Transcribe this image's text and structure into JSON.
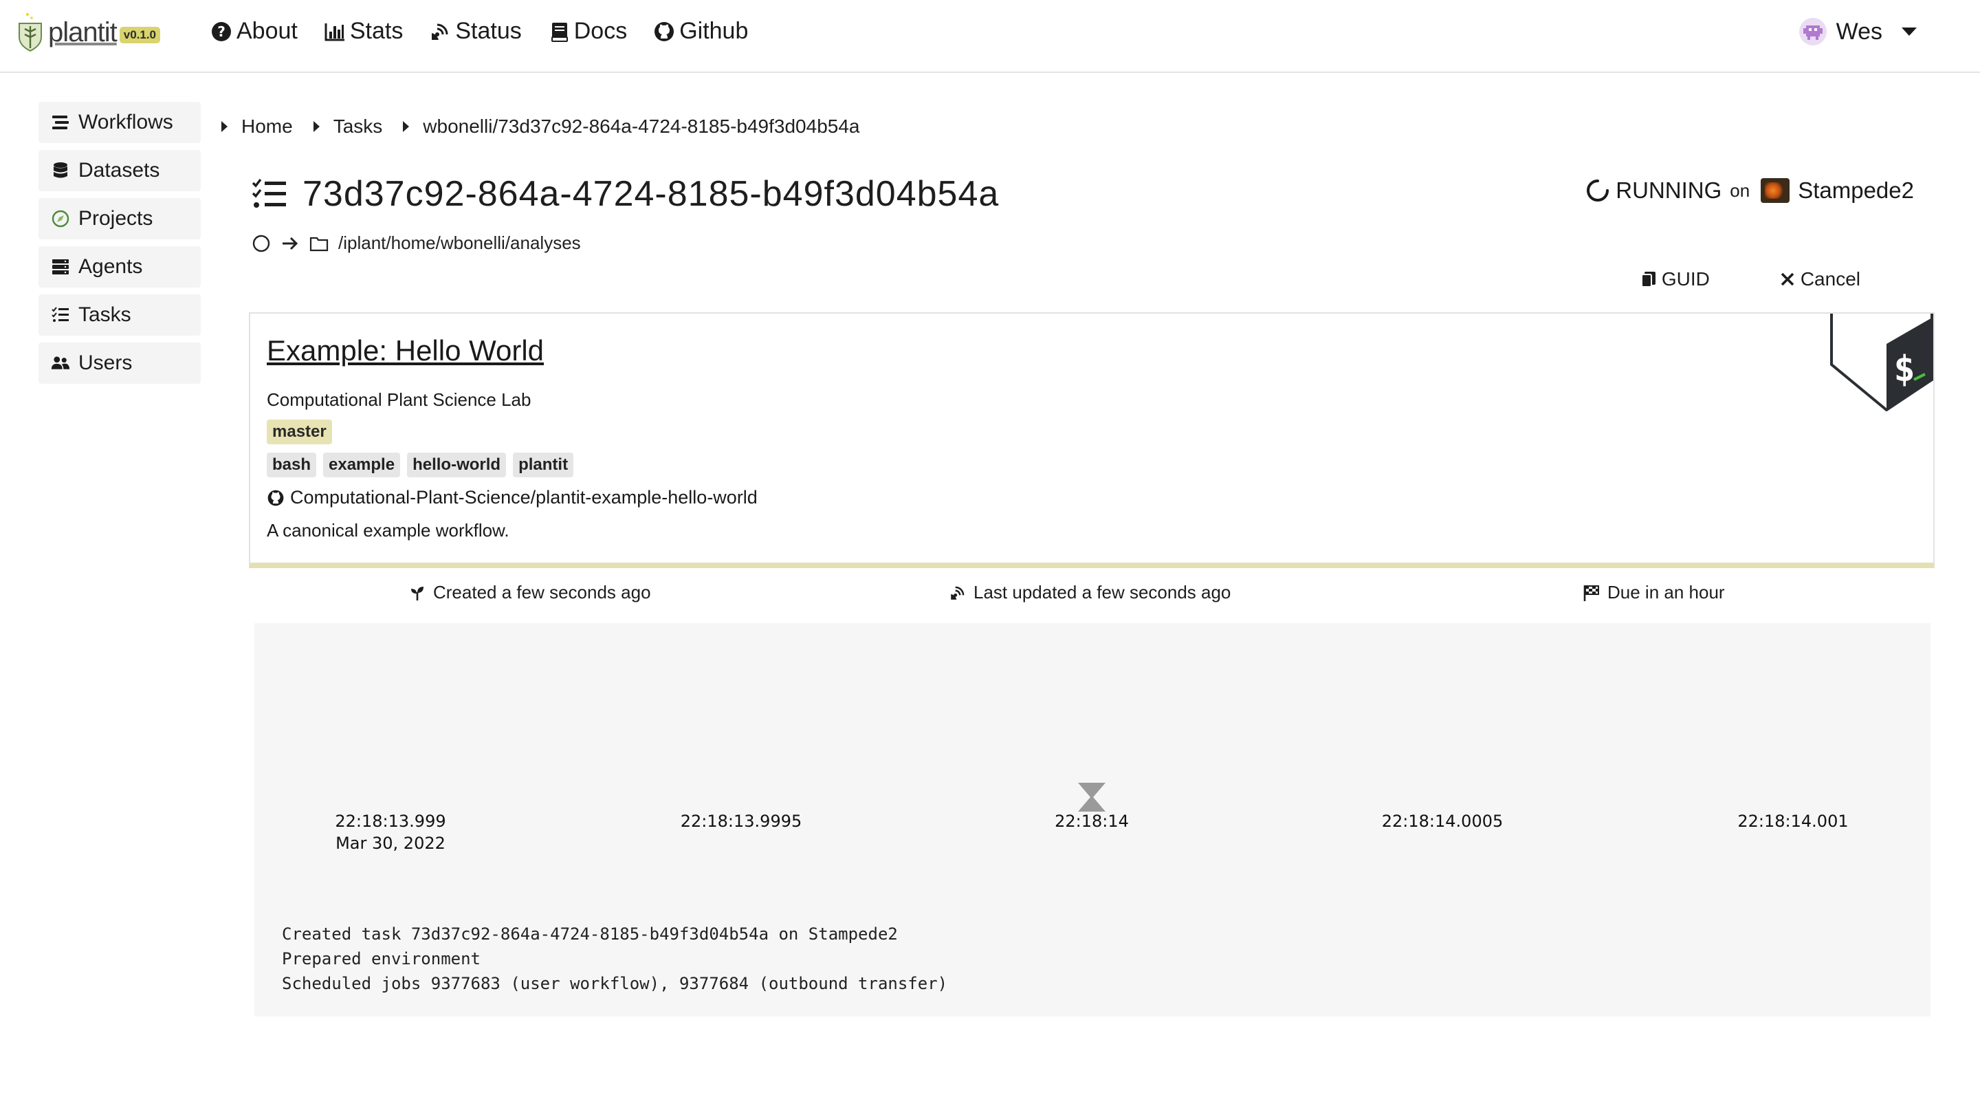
{
  "navbar": {
    "brand_name": "plantit",
    "version": "v0.1.0",
    "links": [
      {
        "label": "About",
        "icon": "question-circle-icon"
      },
      {
        "label": "Stats",
        "icon": "bar-chart-icon"
      },
      {
        "label": "Status",
        "icon": "satellite-dish-icon"
      },
      {
        "label": "Docs",
        "icon": "book-icon"
      },
      {
        "label": "Github",
        "icon": "github-icon"
      }
    ],
    "user": {
      "name": "Wes",
      "avatar": "alien-avatar-icon"
    }
  },
  "sidebar": {
    "items": [
      {
        "label": "Workflows",
        "icon": "stream-icon"
      },
      {
        "label": "Datasets",
        "icon": "database-icon"
      },
      {
        "label": "Projects",
        "icon": "compass-icon"
      },
      {
        "label": "Agents",
        "icon": "server-icon"
      },
      {
        "label": "Tasks",
        "icon": "tasks-icon"
      },
      {
        "label": "Users",
        "icon": "users-icon"
      }
    ]
  },
  "breadcrumb": [
    "Home",
    "Tasks",
    "wbonelli/73d37c92-864a-4724-8185-b49f3d04b54a"
  ],
  "task": {
    "id": "73d37c92-864a-4724-8185-b49f3d04b54a",
    "status": "RUNNING",
    "on_label": "on",
    "cluster": "Stampede2",
    "path": "/iplant/home/wbonelli/analyses",
    "actions": {
      "guid": "GUID",
      "cancel": "Cancel"
    }
  },
  "workflow": {
    "title": "Example: Hello World",
    "org": "Computational Plant Science Lab",
    "branch": "master",
    "topics": [
      "bash",
      "example",
      "hello-world",
      "plantit"
    ],
    "repo": "Computational-Plant-Science/plantit-example-hello-world",
    "description": "A canonical example workflow."
  },
  "meta": {
    "created": "Created a few seconds ago",
    "updated": "Last updated a few seconds ago",
    "due": "Due in an hour"
  },
  "timeline": {
    "ticks": [
      {
        "label": "22:18:13.999",
        "sub": "Mar 30, 2022"
      },
      {
        "label": "22:18:13.9995",
        "sub": ""
      },
      {
        "label": "22:18:14",
        "sub": ""
      },
      {
        "label": "22:18:14.0005",
        "sub": ""
      },
      {
        "label": "22:18:14.001",
        "sub": ""
      }
    ],
    "log": [
      "Created task 73d37c92-864a-4724-8185-b49f3d04b54a on Stampede2",
      "Prepared environment",
      "Scheduled jobs 9377683 (user workflow), 9377684 (outbound transfer)"
    ]
  },
  "colors": {
    "accent": "#d9d46c",
    "branch_tag": "#e8e3b3",
    "topic_tag": "#e6e6e6",
    "timeline_bg": "#f6f6f6"
  }
}
